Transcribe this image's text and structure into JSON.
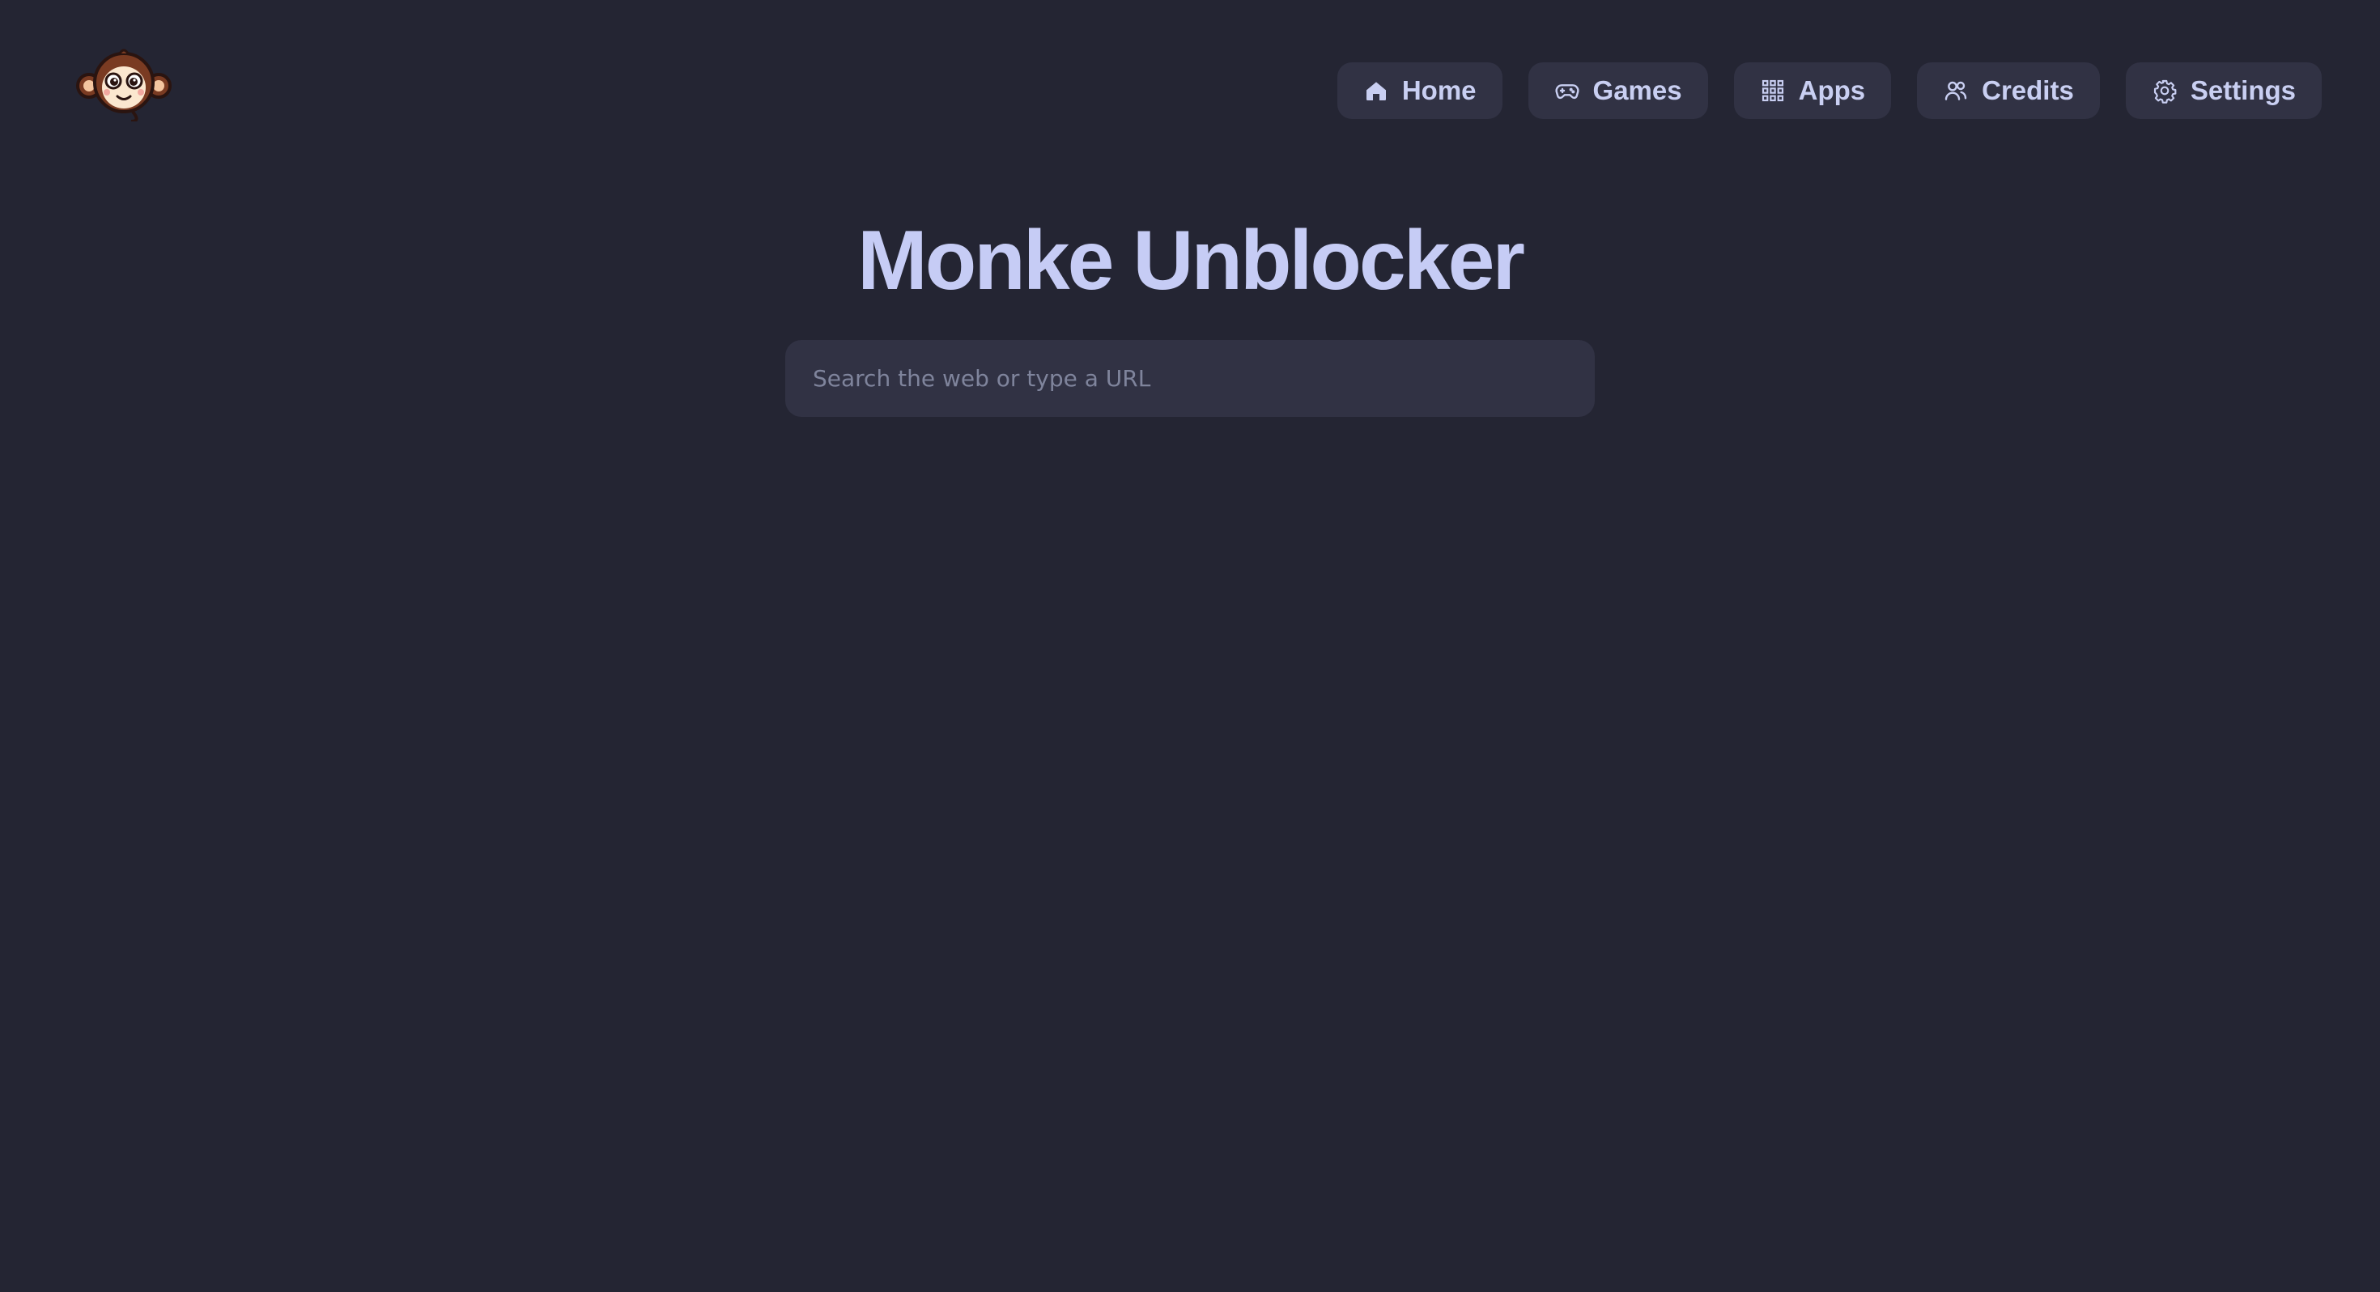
{
  "app": {
    "title": "Monke Unblocker",
    "logo_icon": "monkey-face-icon"
  },
  "nav": {
    "items": [
      {
        "label": "Home",
        "icon": "home-icon"
      },
      {
        "label": "Games",
        "icon": "gamepad-icon"
      },
      {
        "label": "Apps",
        "icon": "grid-icon"
      },
      {
        "label": "Credits",
        "icon": "users-icon"
      },
      {
        "label": "Settings",
        "icon": "gear-icon"
      }
    ]
  },
  "search": {
    "placeholder": "Search the web or type a URL",
    "value": ""
  },
  "colors": {
    "background": "#242533",
    "surface": "#313244",
    "accent_text": "#c6ccf5",
    "placeholder": "#7f849c"
  }
}
